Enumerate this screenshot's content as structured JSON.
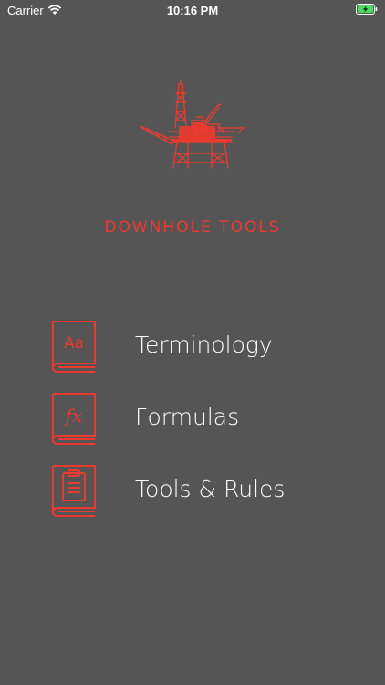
{
  "status": {
    "carrier": "Carrier",
    "time": "10:16 PM"
  },
  "app": {
    "title": "DOWNHOLE TOOLS"
  },
  "colors": {
    "background": "#555555",
    "accent": "#ee3a2e",
    "text": "#ffffff"
  },
  "menu": [
    {
      "label": "Terminology",
      "icon": "dictionary-book-icon",
      "glyph": "Aa"
    },
    {
      "label": "Formulas",
      "icon": "formula-book-icon",
      "glyph": "fx"
    },
    {
      "label": "Tools & Rules",
      "icon": "clipboard-book-icon",
      "glyph": ""
    }
  ]
}
